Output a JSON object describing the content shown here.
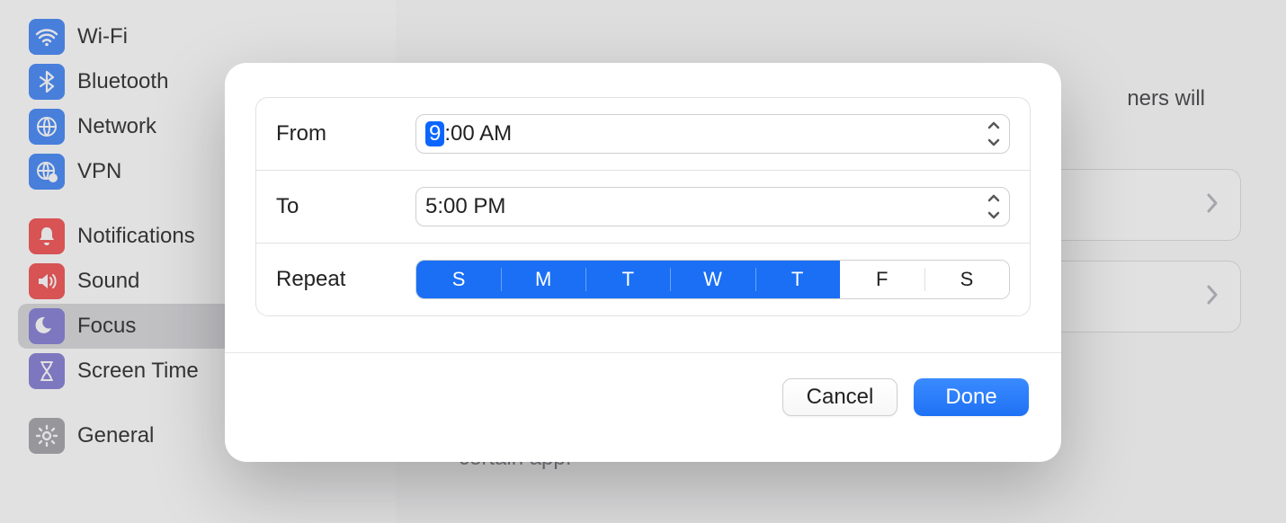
{
  "sidebar": {
    "groups": [
      {
        "items": [
          {
            "label": "Wi-Fi",
            "icon": "wifi",
            "bg": "#3a82f7"
          },
          {
            "label": "Bluetooth",
            "icon": "bluetooth",
            "bg": "#3a82f7"
          },
          {
            "label": "Network",
            "icon": "globe",
            "bg": "#3a82f7"
          },
          {
            "label": "VPN",
            "icon": "globe-badge",
            "bg": "#3a82f7"
          }
        ]
      },
      {
        "items": [
          {
            "label": "Notifications",
            "icon": "bell",
            "bg": "#f24a4a"
          },
          {
            "label": "Sound",
            "icon": "speaker",
            "bg": "#f24a4a"
          },
          {
            "label": "Focus",
            "icon": "moon",
            "bg": "#7f78d2",
            "selected": true
          },
          {
            "label": "Screen Time",
            "icon": "hourglass",
            "bg": "#7f78d2"
          }
        ]
      },
      {
        "items": [
          {
            "label": "General",
            "icon": "gear",
            "bg": "#9f9fa5"
          }
        ]
      }
    ]
  },
  "content": {
    "help_top_fragment": "ners will",
    "help_bottom_fragment": "certain app."
  },
  "modal": {
    "rows": {
      "from": {
        "label": "From",
        "hour_sel": "9",
        "rest": ":00 AM"
      },
      "to": {
        "label": "To",
        "time": "5:00 PM"
      },
      "repeat": {
        "label": "Repeat"
      }
    },
    "days": [
      {
        "label": "S",
        "on": true
      },
      {
        "label": "M",
        "on": true
      },
      {
        "label": "T",
        "on": true
      },
      {
        "label": "W",
        "on": true
      },
      {
        "label": "T",
        "on": true
      },
      {
        "label": "F",
        "on": false
      },
      {
        "label": "S",
        "on": false
      }
    ],
    "buttons": {
      "cancel": "Cancel",
      "done": "Done"
    }
  }
}
